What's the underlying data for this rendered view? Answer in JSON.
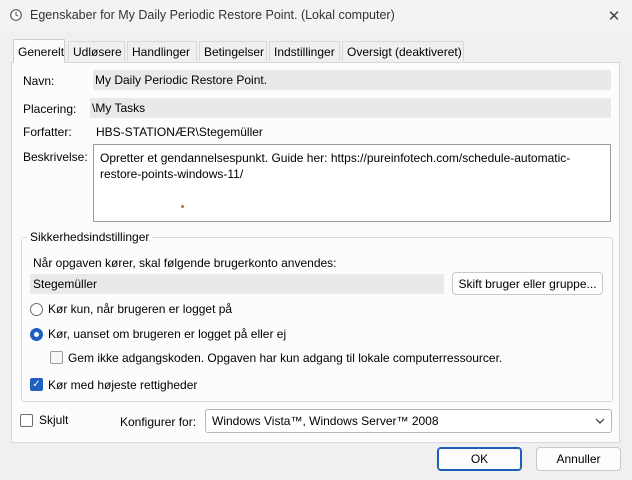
{
  "window": {
    "title": "Egenskaber for My Daily Periodic Restore Point. (Lokal computer)",
    "close_glyph": "✕"
  },
  "tabs": [
    {
      "label": "Generelt",
      "active": true
    },
    {
      "label": "Udløsere",
      "active": false
    },
    {
      "label": "Handlinger",
      "active": false
    },
    {
      "label": "Betingelser",
      "active": false
    },
    {
      "label": "Indstillinger",
      "active": false
    },
    {
      "label": "Oversigt (deaktiveret)",
      "active": false
    }
  ],
  "general": {
    "name_label": "Navn:",
    "name_value": "My Daily Periodic Restore Point.",
    "location_label": "Placering:",
    "location_value": "\\My Tasks",
    "author_label": "Forfatter:",
    "author_value": "HBS-STATIONÆR\\Stegemüller",
    "description_label": "Beskrivelse:",
    "description_value": "Opretter et gendannelsespunkt. Guide her: https://pureinfotech.com/schedule-automatic-restore-points-windows-11/"
  },
  "security": {
    "legend": "Sikkerhedsindstillinger",
    "account_prompt": "Når opgaven kører, skal følgende brugerkonto anvendes:",
    "account_value": "Stegemüller",
    "change_user_button": "Skift bruger eller gruppe...",
    "radio_logged_on": {
      "label": "Kør kun, når brugeren er logget på",
      "checked": false
    },
    "radio_always": {
      "label": "Kør, uanset om brugeren er logget på eller ej",
      "checked": true
    },
    "checkbox_no_password": {
      "label": "Gem ikke adgangskoden. Opgaven har kun adgang til lokale computerressourcer.",
      "checked": false
    },
    "checkbox_highest": {
      "label": "Kør med højeste rettigheder",
      "checked": true
    }
  },
  "footer": {
    "hidden_label": "Skjult",
    "hidden_checked": false,
    "configure_label": "Konfigurer for:",
    "configure_value": "Windows Vista™, Windows Server™ 2008",
    "ok_button": "OK",
    "cancel_button": "Annuller"
  },
  "icons": {
    "title": "task-clock-icon",
    "close": "close-icon",
    "dropdown": "chevron-down-icon",
    "check": "checkmark-icon"
  },
  "colors": {
    "accent": "#1f5fbf",
    "window_bg": "#f0f0f0",
    "panel_bg": "#fcfcfc",
    "readonly_field_bg": "#e9e9e9"
  }
}
